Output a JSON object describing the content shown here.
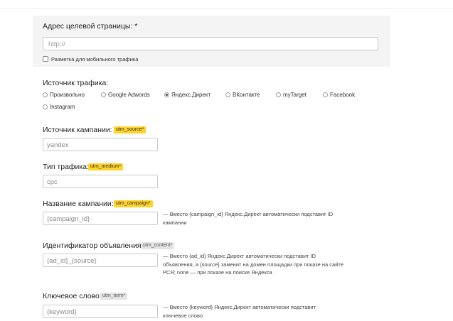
{
  "target_url": {
    "label": "Адрес целевой страницы: *",
    "placeholder": "http://",
    "mobile_checkbox_label": "Разметка для мобильного трафика"
  },
  "traffic_source": {
    "label": "Источник трафика:",
    "options": [
      "Произвольно",
      "Google Adwords",
      "Яндекс.Директ",
      "ВКонтакте",
      "myTarget",
      "Facebook",
      "Instagram"
    ],
    "selected": "Яндекс.Директ"
  },
  "fields": [
    {
      "label": "Источник кампании:",
      "param": "utm_source*",
      "value": "yandex",
      "note": ""
    },
    {
      "label": "Тип трафика:",
      "param": "utm_medium*",
      "value": "cpc",
      "note": ""
    },
    {
      "label": "Название кампании:",
      "param": "utm_campaign*",
      "value": "{campaign_id}",
      "note": "— Вместо {campaign_id} Яндекс.Директ автоматически подставит ID кампании"
    },
    {
      "label": "Идентификатор объявления:",
      "param": "utm_content*",
      "value": "{ad_id}_{source}",
      "note": "— Вместо {ad_id} Яндекс.Директ автоматически подставит ID объявления, а {source} заменит на домен площадки при показе на сайте РСЯ; none — при показе на поиске Яндекса"
    },
    {
      "label": "Ключевое слово:",
      "param": "utm_term*",
      "value": "{keyword}",
      "note": "— Вместо {keyword} Яндекс.Директ автоматически подставит ключевое слово"
    }
  ],
  "colors": {
    "required_badge": "#ffd32a",
    "optional_badge": "#e4e4e4",
    "panel": "#f4f4f4"
  }
}
